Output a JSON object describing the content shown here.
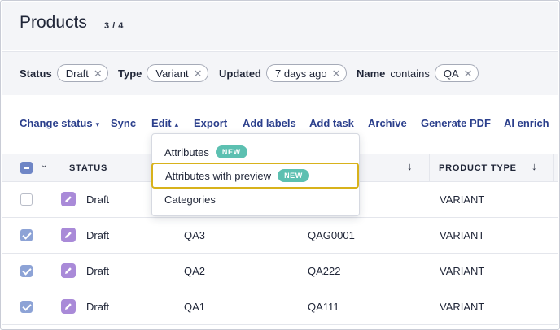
{
  "header": {
    "title": "Products",
    "count": "3 / 4"
  },
  "filters": [
    {
      "label": "Status",
      "op": "",
      "value": "Draft"
    },
    {
      "label": "Type",
      "op": "",
      "value": "Variant"
    },
    {
      "label": "Updated",
      "op": "",
      "value": "7 days ago"
    },
    {
      "label": "Name",
      "op": "contains",
      "value": "QA"
    }
  ],
  "toolbar": {
    "change_status": "Change status",
    "sync": "Sync",
    "edit": "Edit",
    "export": "Export",
    "add_labels": "Add labels",
    "add_task": "Add task",
    "archive": "Archive",
    "generate_pdf": "Generate PDF",
    "ai_enrich": "AI enrich"
  },
  "edit_menu": {
    "items": [
      {
        "label": "Attributes",
        "badge": "NEW"
      },
      {
        "label": "Attributes with preview",
        "badge": "NEW"
      },
      {
        "label": "Categories",
        "badge": ""
      }
    ]
  },
  "table": {
    "columns": {
      "status": "STATUS",
      "product_type": "PRODUCT TYPE"
    },
    "rows": [
      {
        "checked": false,
        "status": "Draft",
        "name": "",
        "sku": "",
        "type": "VARIANT"
      },
      {
        "checked": true,
        "status": "Draft",
        "name": "QA3",
        "sku": "QAG0001",
        "type": "VARIANT"
      },
      {
        "checked": true,
        "status": "Draft",
        "name": "QA2",
        "sku": "QA222",
        "type": "VARIANT"
      },
      {
        "checked": true,
        "status": "Draft",
        "name": "QA1",
        "sku": "QA111",
        "type": "VARIANT"
      }
    ]
  },
  "colors": {
    "accent": "#2b3f8c",
    "badge": "#5cc0b1",
    "highlight": "#d8b21b",
    "status_icon": "#a98ad8",
    "checkbox": "#8da3d6"
  },
  "icons": {
    "chip_remove": "close-icon",
    "status": "pencil-icon",
    "sort": "arrow-down-icon",
    "menu": "chevron-icon"
  }
}
